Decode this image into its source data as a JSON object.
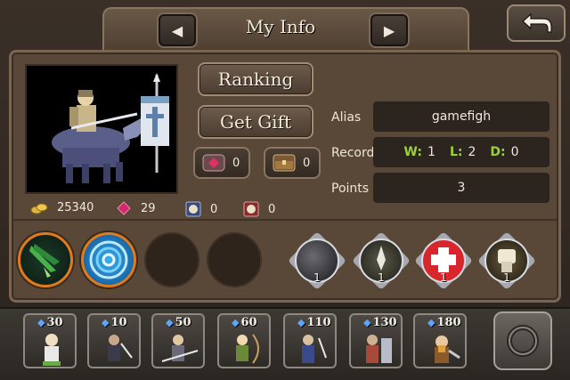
{
  "header": {
    "title": "My Info",
    "prev_icon": "◀",
    "next_icon": "▶",
    "back_icon": "back-arrow-icon"
  },
  "buttons": {
    "ranking": "Ranking",
    "get_gift": "Get Gift"
  },
  "mini_counters": {
    "gem": "0",
    "chest": "0"
  },
  "info": {
    "alias_label": "Alias",
    "alias_value": "gamefigh",
    "record_label": "Record",
    "record": {
      "w_label": "W:",
      "w_value": "1",
      "l_label": "L:",
      "l_value": "2",
      "d_label": "D:",
      "d_value": "0"
    },
    "points_label": "Points",
    "points_value": "3"
  },
  "resources": {
    "gold": "25340",
    "gems": "29",
    "timer1": "0",
    "timer2": "0"
  },
  "skills": [
    {
      "name": "green-blade-skill-icon"
    },
    {
      "name": "blue-vortex-skill-icon"
    },
    {
      "name": "empty-skill-slot"
    },
    {
      "name": "empty-skill-slot"
    }
  ],
  "items": [
    {
      "name": "bomb-item-icon",
      "count": "1"
    },
    {
      "name": "spear-item-icon",
      "count": "1"
    },
    {
      "name": "heal-cross-item-icon",
      "count": "1"
    },
    {
      "name": "fist-item-icon",
      "count": "1"
    }
  ],
  "units": [
    {
      "cost": "30"
    },
    {
      "cost": "10"
    },
    {
      "cost": "50"
    },
    {
      "cost": "60"
    },
    {
      "cost": "110"
    },
    {
      "cost": "130"
    },
    {
      "cost": "180"
    }
  ],
  "colors": {
    "record_key": "#9bd23a",
    "skill_ring": "#e07a1e",
    "heal_red": "#d8262c",
    "gem_blue": "#5aa8ff"
  }
}
